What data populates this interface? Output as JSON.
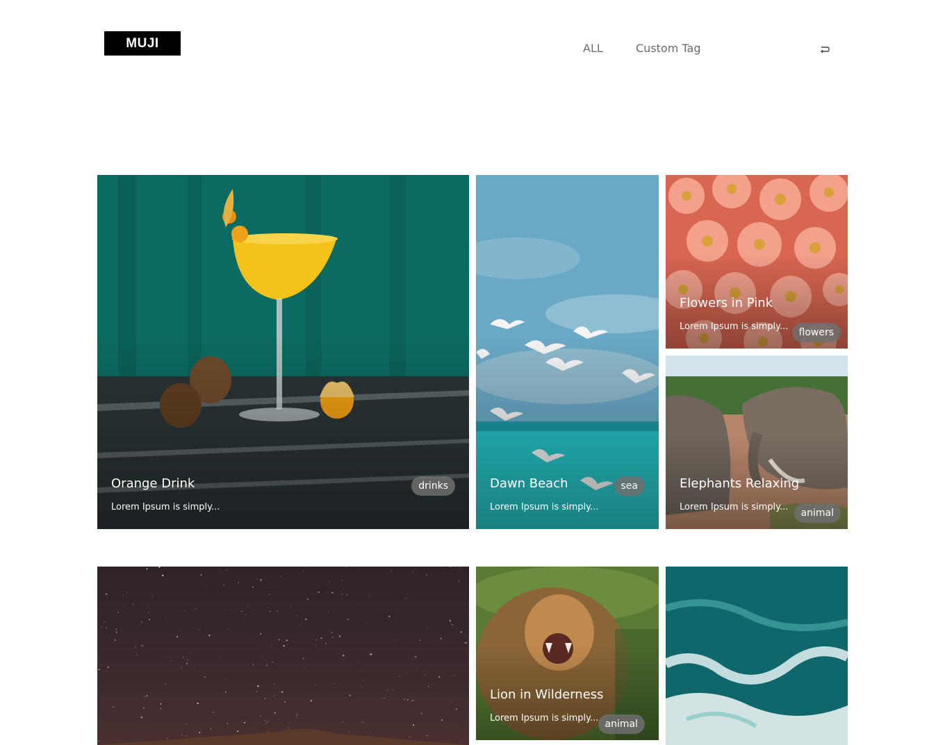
{
  "header": {
    "logo": "MUJI",
    "nav": [
      "ALL",
      "Custom Tag"
    ],
    "theme_toggle_icon": "theme-toggle-icon"
  },
  "cards": [
    {
      "title": "Orange Drink",
      "excerpt": "Lorem Ipsum is simply...",
      "tag": "drinks"
    },
    {
      "title": "Dawn Beach",
      "excerpt": "Lorem Ipsum is simply...",
      "tag": "sea"
    },
    {
      "title": "Flowers in Pink",
      "excerpt": "Lorem Ipsum is simply...",
      "tag": "flowers"
    },
    {
      "title": "Elephants Relaxing",
      "excerpt": "Lorem Ipsum is simply...",
      "tag": "animal"
    },
    {
      "title": "",
      "excerpt": "",
      "tag": ""
    },
    {
      "title": "Lion in Wilderness",
      "excerpt": "Lorem Ipsum is simply...",
      "tag": "animal"
    },
    {
      "title": "",
      "excerpt": "",
      "tag": ""
    }
  ]
}
